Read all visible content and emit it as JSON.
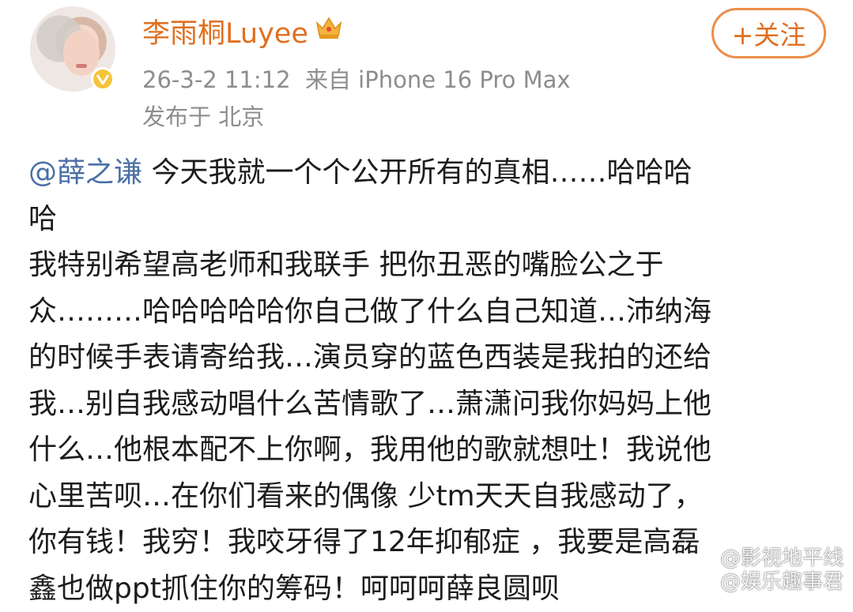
{
  "post": {
    "username": "李雨桐Luyee",
    "timestamp": "26-3-2 11:12",
    "source": "来自 iPhone 16 Pro Max",
    "location": "发布于 北京",
    "follow_label": "+关注",
    "icons": {
      "avatar": "avatar",
      "verified": "verified-badge-icon",
      "crown": "crown-icon"
    },
    "colors": {
      "username": "#e06f20",
      "mention": "#4a6fa5",
      "meta": "#8d8d8d"
    },
    "mention": "@薛之谦",
    "lines": [
      " 今天我就一个个公开所有的真相……哈哈哈",
      "哈",
      "我特别希望高老师和我联手 把你丑恶的嘴脸公之于",
      "众………哈哈哈哈哈你自己做了什么自己知道…沛纳海",
      "的时候手表请寄给我…演员穿的蓝色西装是我拍的还给",
      "我…别自我感动唱什么苦情歌了…萧潇问我你妈妈上他",
      "什么…他根本配不上你啊，我用他的歌就想吐！我说他",
      "心里苦呗…在你们看来的偶像 少tm天天自我感动了，",
      "你有钱！我穷！我咬牙得了12年抑郁症 ，我要是高磊",
      "鑫也做ppt抓住你的筹码！呵呵呵薛良圆呗"
    ]
  },
  "watermark": {
    "line1": "@影视地平线",
    "line2": "@娱乐趣事君"
  }
}
